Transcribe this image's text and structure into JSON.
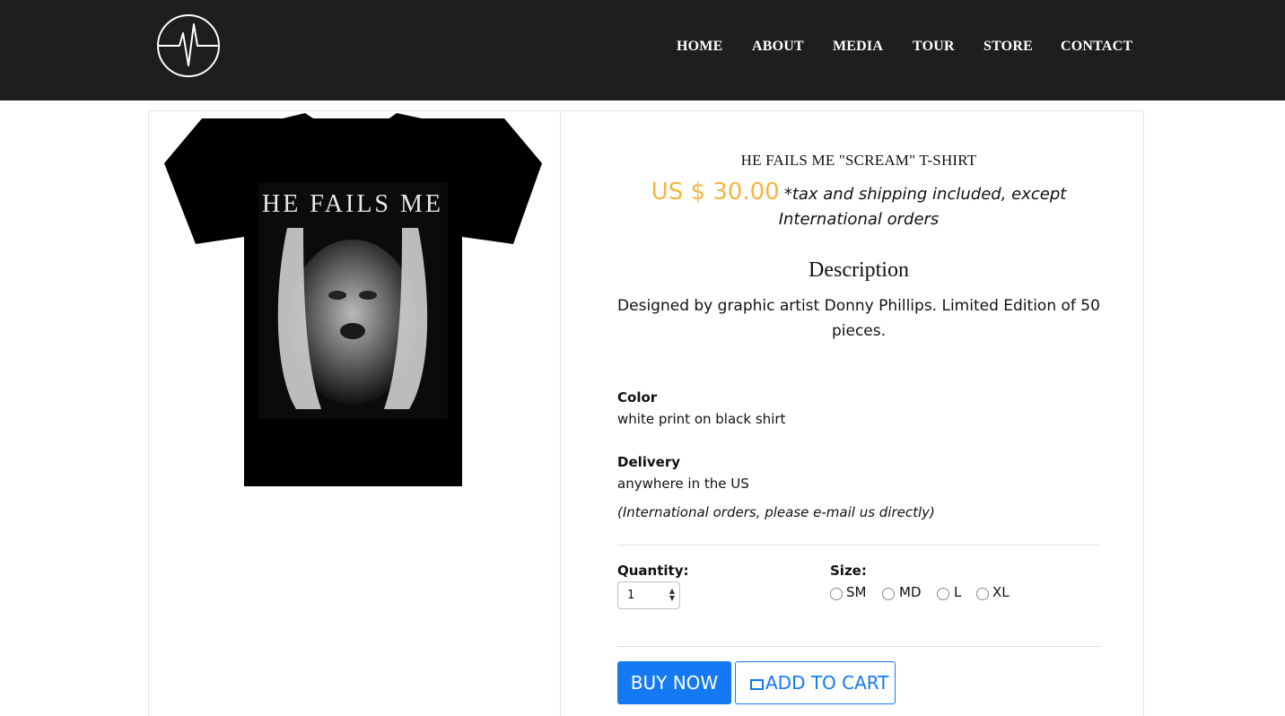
{
  "nav": {
    "logo_icon": "heartbeat-circle-icon",
    "items": [
      "HOME",
      "ABOUT",
      "MEDIA",
      "TOUR",
      "STORE",
      "CONTACT"
    ]
  },
  "product": {
    "image_text": "HE FAILS ME",
    "title": "HE FAILS ME \"SCREAM\" T-SHIRT",
    "price": "US $ 30.00",
    "price_note": "*tax and shipping included, except International orders",
    "description_heading": "Description",
    "description": "Designed by graphic artist Donny Phillips. Limited Edition of 50 pieces.",
    "color_label": "Color",
    "color_value": "white print on black shirt",
    "delivery_label": "Delivery",
    "delivery_value": "anywhere in the US",
    "delivery_note": "(International orders, please e-mail us directly)",
    "quantity_label": "Quantity:",
    "quantity_value": "1",
    "size_label": "Size:",
    "sizes": [
      "SM",
      "MD",
      "L",
      "XL"
    ],
    "buy_label": "BUY NOW",
    "cart_label": "ADD TO CART"
  },
  "colors": {
    "nav_bg": "#1e1e1e",
    "price": "#f3b640",
    "accent": "#1479f2"
  }
}
